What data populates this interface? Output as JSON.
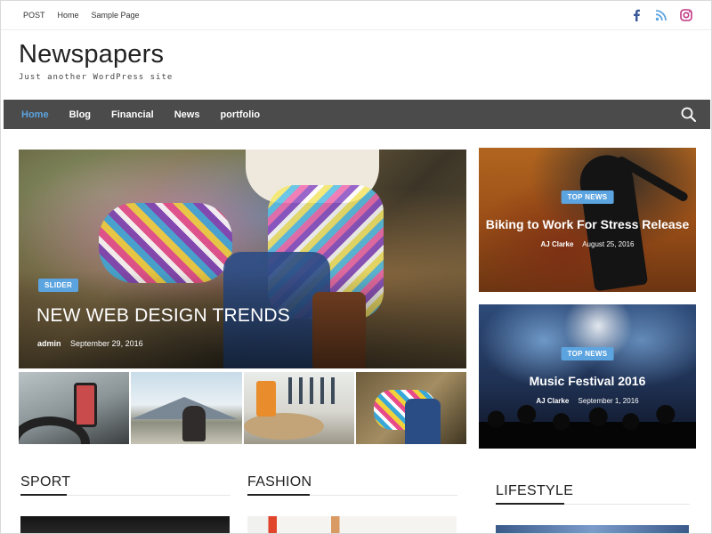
{
  "topbar": {
    "links": [
      "POST",
      "Home",
      "Sample Page"
    ],
    "social": [
      {
        "icon": "facebook-icon",
        "color": "#3b5998"
      },
      {
        "icon": "rss-icon",
        "color": "#5ca4e0"
      },
      {
        "icon": "instagram-icon",
        "color": "#c13584"
      }
    ]
  },
  "site": {
    "title": "Newspapers",
    "description": "Just another WordPress site"
  },
  "nav": {
    "items": [
      "Home",
      "Blog",
      "Financial",
      "News",
      "portfolio"
    ],
    "active": "Home",
    "search_icon": "search-icon"
  },
  "slider": {
    "badge": "SLIDER",
    "title": "NEW WEB DESIGN TRENDS",
    "author": "admin",
    "date": "September 29, 2016"
  },
  "featured": [
    {
      "badge": "TOP NEWS",
      "title": "Biking to Work For Stress Release",
      "author": "AJ Clarke",
      "date": "August 25, 2016"
    },
    {
      "badge": "TOP NEWS",
      "title": "Music Festival 2016",
      "author": "AJ Clarke",
      "date": "September 1, 2016"
    }
  ],
  "sections": {
    "sport": "SPORT",
    "fashion": "FASHION",
    "lifestyle": "LIFESTYLE"
  },
  "colors": {
    "accent": "#5ca4e0",
    "nav_bg": "#4b4b4b"
  }
}
